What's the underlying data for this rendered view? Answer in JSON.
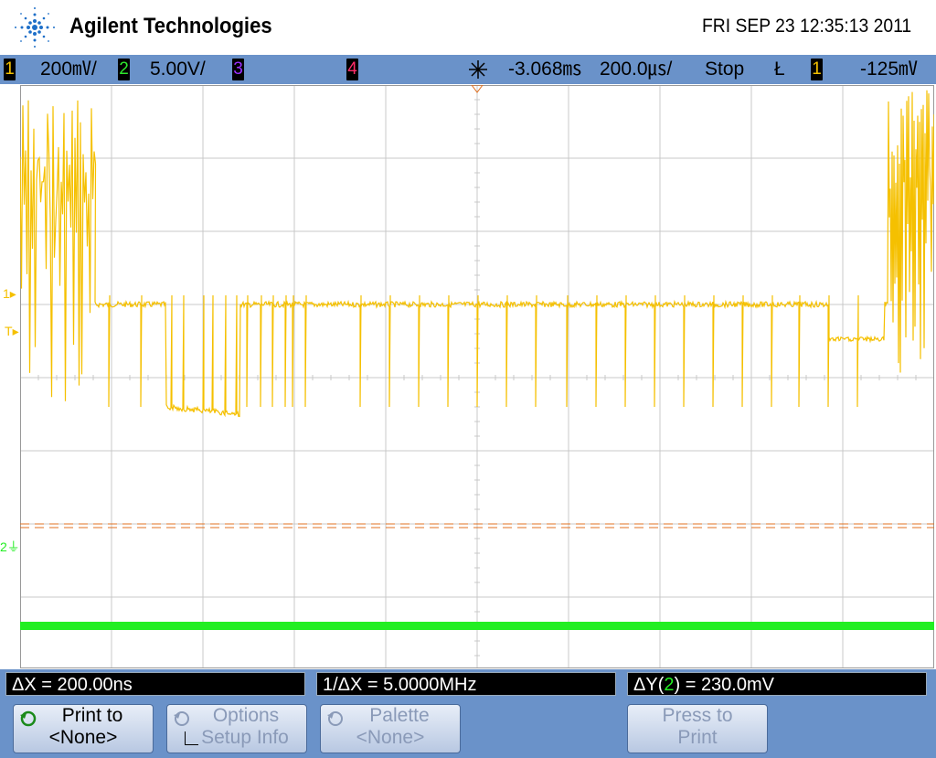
{
  "brand": {
    "name": "Agilent Technologies",
    "datetime": "FRI SEP 23 12:35:13 2011"
  },
  "status": {
    "ch1": {
      "num": "1",
      "scale": "200㎷/"
    },
    "ch2": {
      "num": "2",
      "scale": "5.00V/"
    },
    "ch3": {
      "num": "3"
    },
    "ch4": {
      "num": "4"
    },
    "delay": "-3.068㎳",
    "timebase": "200.0㎲/",
    "run_state": "Stop",
    "trigger_slope": "Ł",
    "trigger_source": "1",
    "trigger_level": "-125㎷"
  },
  "markers": {
    "ch1_ground": "1",
    "trigger": "T",
    "ch2_ground": "2"
  },
  "measurements": {
    "dx": "ΔX = 200.00ns",
    "inv_dx": "1/ΔX = 5.0000MHz",
    "dy_prefix": "ΔY(",
    "dy_channel": "2",
    "dy_suffix": ") = 230.0mV"
  },
  "softkeys": {
    "print_to": {
      "line1": "Print to",
      "line2": "<None>"
    },
    "options": {
      "line1": "Options",
      "line2": "Setup Info"
    },
    "palette": {
      "line1": "Palette",
      "line2": "<None>"
    },
    "press_print": {
      "line1": "Press to",
      "line2": "Print"
    }
  },
  "colors": {
    "ch1": "#f5c000",
    "ch2": "#22ee22",
    "cursor": "#e07020",
    "status_bar": "#6a92c9"
  },
  "waveform": {
    "ch1_baseline_div": 0.0,
    "ch1_low_div": -1.5,
    "ch1_spike_div": -1.5,
    "ch1_burst_div": 3.0,
    "ch2_level_div": -3.4
  }
}
